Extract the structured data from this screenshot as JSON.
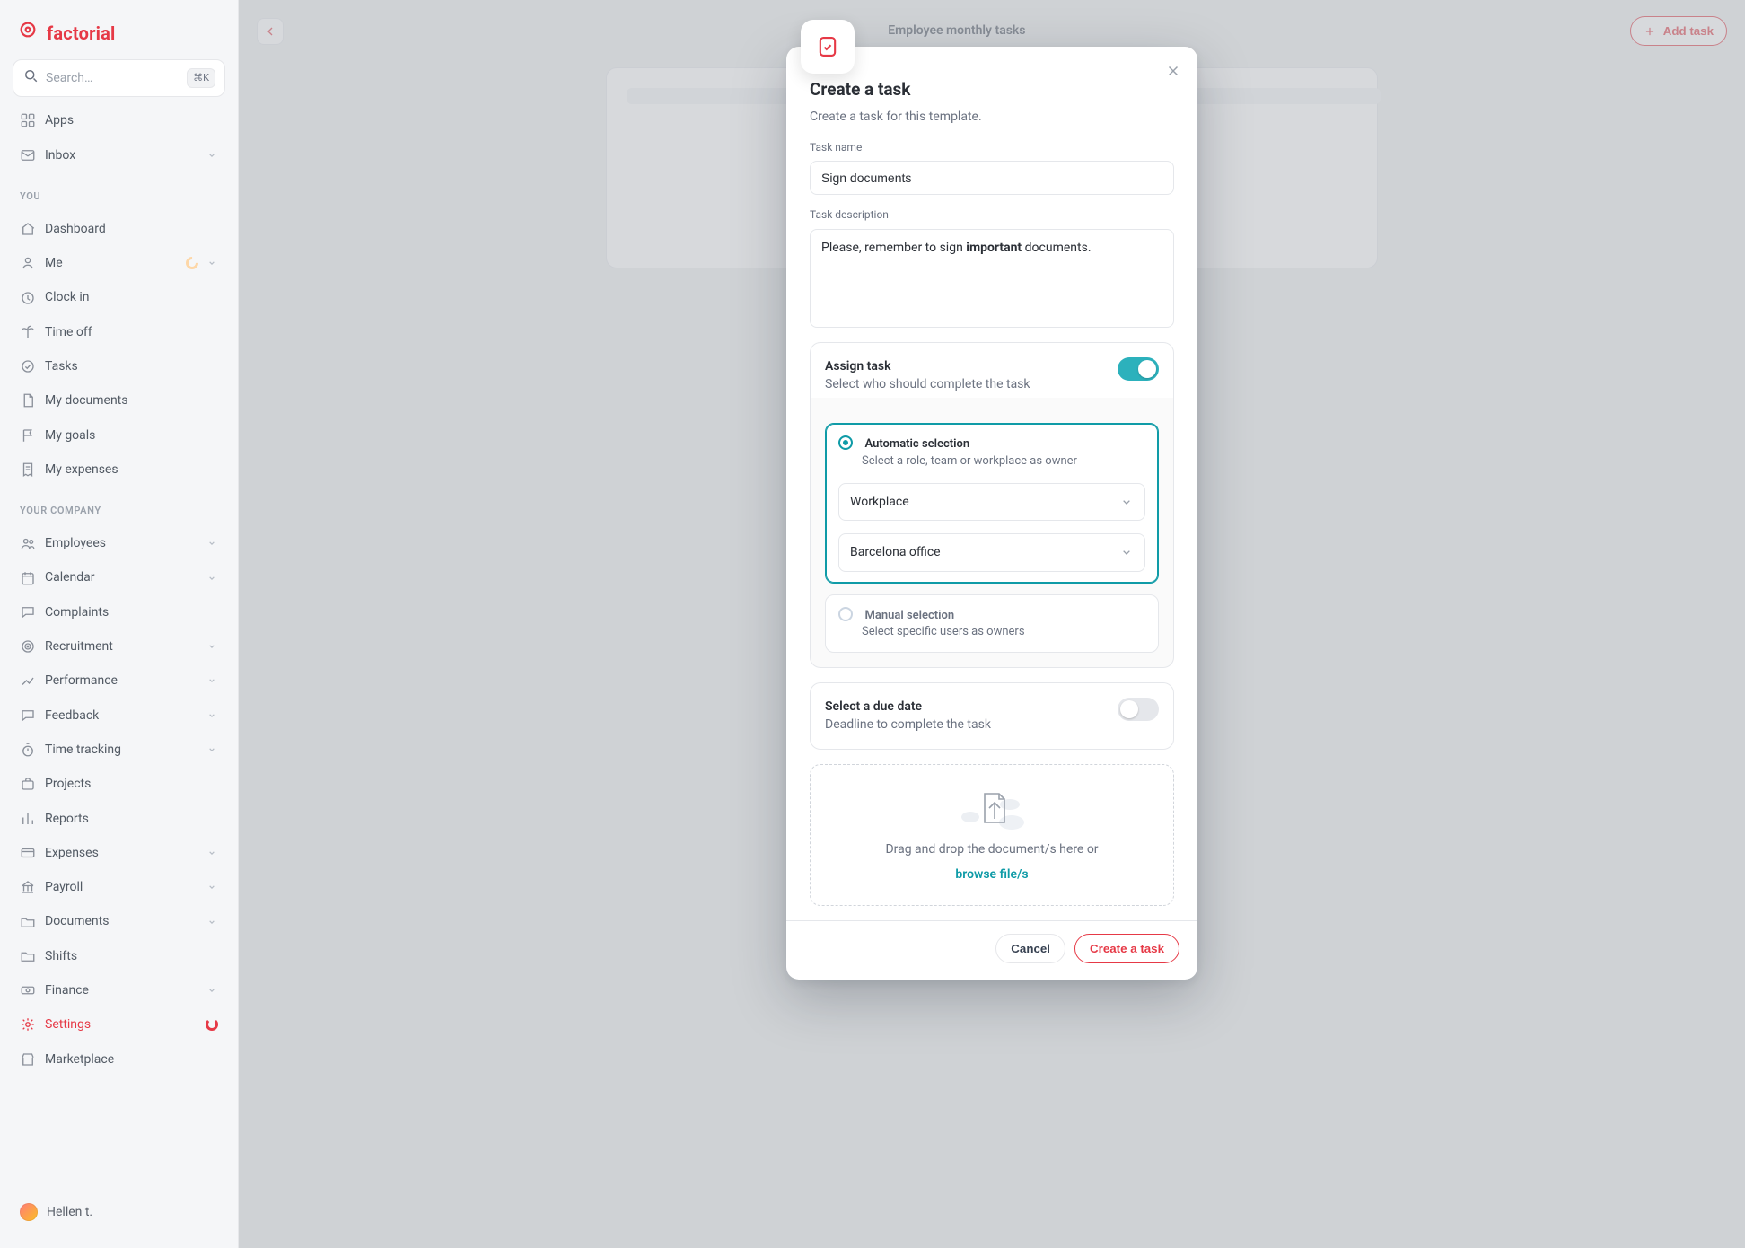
{
  "brand": {
    "name": "factorial"
  },
  "search": {
    "placeholder": "Search…",
    "kbd": "⌘K"
  },
  "sections": {
    "you": "YOU",
    "company": "YOUR COMPANY"
  },
  "top_nav": [
    {
      "key": "apps",
      "label": "Apps",
      "icon": "grid"
    },
    {
      "key": "inbox",
      "label": "Inbox",
      "icon": "mail",
      "chevron": true
    }
  ],
  "you_nav": [
    {
      "key": "dashboard",
      "label": "Dashboard",
      "icon": "home"
    },
    {
      "key": "me",
      "label": "Me",
      "icon": "user",
      "chevron": true,
      "loading": true
    },
    {
      "key": "clockin",
      "label": "Clock in",
      "icon": "clock"
    },
    {
      "key": "timeoff",
      "label": "Time off",
      "icon": "palm"
    },
    {
      "key": "tasks",
      "label": "Tasks",
      "icon": "check"
    },
    {
      "key": "mydocs",
      "label": "My documents",
      "icon": "doc"
    },
    {
      "key": "mygoals",
      "label": "My goals",
      "icon": "flag"
    },
    {
      "key": "myexpenses",
      "label": "My expenses",
      "icon": "receipt"
    }
  ],
  "company_nav": [
    {
      "key": "employees",
      "label": "Employees",
      "icon": "people",
      "chevron": true
    },
    {
      "key": "calendar",
      "label": "Calendar",
      "icon": "calendar",
      "chevron": true
    },
    {
      "key": "complaints",
      "label": "Complaints",
      "icon": "speech"
    },
    {
      "key": "recruitment",
      "label": "Recruitment",
      "icon": "target",
      "chevron": true
    },
    {
      "key": "performance",
      "label": "Performance",
      "icon": "trend",
      "chevron": true
    },
    {
      "key": "feedback",
      "label": "Feedback",
      "icon": "speech",
      "chevron": true
    },
    {
      "key": "timetracking",
      "label": "Time tracking",
      "icon": "stopwatch",
      "chevron": true
    },
    {
      "key": "projects",
      "label": "Projects",
      "icon": "briefcase"
    },
    {
      "key": "reports",
      "label": "Reports",
      "icon": "bar"
    },
    {
      "key": "expenses",
      "label": "Expenses",
      "icon": "card",
      "chevron": true
    },
    {
      "key": "payroll",
      "label": "Payroll",
      "icon": "bank",
      "chevron": true
    },
    {
      "key": "documents",
      "label": "Documents",
      "icon": "folder",
      "chevron": true
    },
    {
      "key": "shifts",
      "label": "Shifts",
      "icon": "folder"
    },
    {
      "key": "finance",
      "label": "Finance",
      "icon": "money",
      "chevron": true
    },
    {
      "key": "settings",
      "label": "Settings",
      "icon": "gear",
      "active": true,
      "spinner": true
    },
    {
      "key": "marketplace",
      "label": "Marketplace",
      "icon": "store"
    }
  ],
  "user": {
    "name": "Hellen t."
  },
  "header": {
    "title": "Employee monthly tasks",
    "add_task_label": "Add task"
  },
  "modal": {
    "title": "Create a task",
    "subtitle": "Create a task for this template.",
    "fields": {
      "name_label": "Task name",
      "name_value": "Sign documents",
      "desc_label": "Task description",
      "desc_value_prefix": "Please, remember to sign ",
      "desc_value_strong": "important",
      "desc_value_suffix": " documents."
    },
    "assign": {
      "title": "Assign task",
      "subtitle": "Select who should complete the task",
      "automatic": {
        "title": "Automatic selection",
        "desc": "Select a role, team or workplace as owner"
      },
      "manual": {
        "title": "Manual selection",
        "desc": "Select specific users as owners"
      },
      "selects": {
        "type": "Workplace",
        "value": "Barcelona office"
      }
    },
    "due": {
      "title": "Select a due date",
      "subtitle": "Deadline to complete the task"
    },
    "dropzone": {
      "text": "Drag and drop the document/s here or",
      "link": "browse file/s"
    },
    "actions": {
      "cancel": "Cancel",
      "create": "Create a task"
    }
  }
}
